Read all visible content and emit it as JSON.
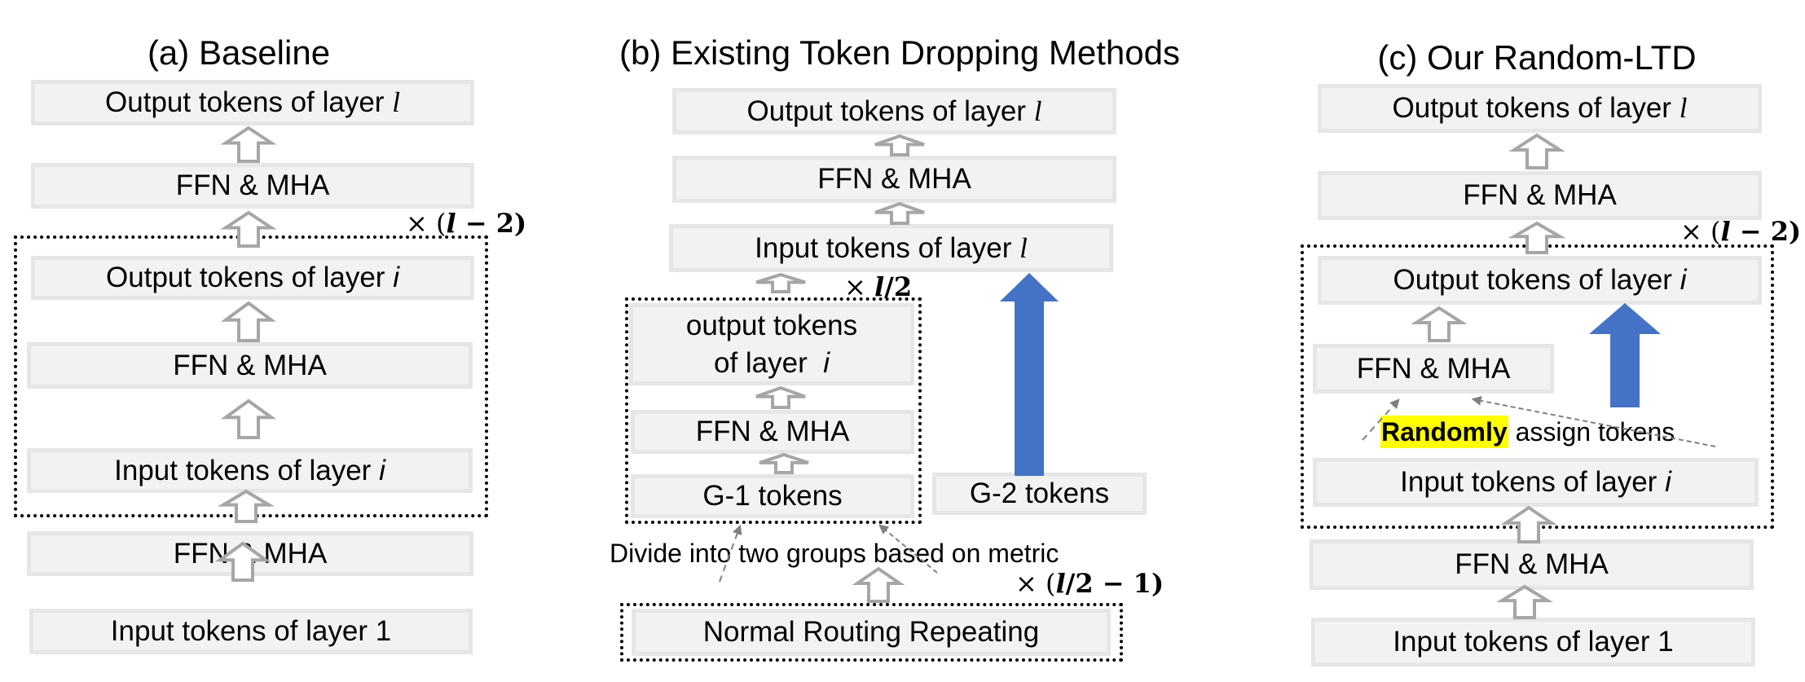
{
  "panels": {
    "a": {
      "title": "(a) Baseline",
      "boxes": {
        "output_l": {
          "text": "Output tokens of layer ",
          "var": "l"
        },
        "ffn_top": {
          "text": "FFN & MHA"
        },
        "output_i": {
          "text": "Output tokens of layer ",
          "var": "i"
        },
        "ffn_mid": {
          "text": "FFN & MHA"
        },
        "input_i": {
          "text": "Input tokens of layer ",
          "var": "i"
        },
        "ffn_bottom": {
          "text": "FFN & MHA"
        },
        "input_1": {
          "text": "Input tokens of layer 1"
        }
      },
      "repeat": {
        "prefix": "× (",
        "var": "l",
        "suffix": " − 2)"
      }
    },
    "b": {
      "title": "(b) Existing Token Dropping Methods",
      "boxes": {
        "output_l": {
          "text": "Output tokens of layer ",
          "var": "l"
        },
        "ffn_top": {
          "text": "FFN & MHA"
        },
        "input_l": {
          "text": "Input tokens of layer ",
          "var": "l"
        },
        "output_i_line1": {
          "text": "output tokens"
        },
        "output_i_line2": {
          "text": "of layer ",
          "var": "i"
        },
        "ffn_mid": {
          "text": "FFN & MHA"
        },
        "g1": {
          "text": "G-1 tokens"
        },
        "g2": {
          "text": "G-2 tokens"
        },
        "normal_routing": {
          "text": "Normal Routing Repeating"
        }
      },
      "repeat_inner": {
        "prefix": "× ",
        "var": "l",
        "suffix": "/2"
      },
      "repeat_outer": {
        "prefix": "× (",
        "var": "l",
        "suffix": "/2 − 1)"
      },
      "divide_note": "Divide into two groups based on metric"
    },
    "c": {
      "title": "(c) Our Random-LTD",
      "boxes": {
        "output_l": {
          "text": "Output tokens of layer ",
          "var": "l"
        },
        "ffn_top": {
          "text": "FFN & MHA"
        },
        "output_i": {
          "text": "Output tokens of layer ",
          "var": "i"
        },
        "ffn_mid": {
          "text": "FFN & MHA"
        },
        "input_i": {
          "text": "Input tokens of layer ",
          "var": "i"
        },
        "ffn_bottom": {
          "text": "FFN & MHA"
        },
        "input_1": {
          "text": "Input tokens of layer 1"
        }
      },
      "repeat": {
        "prefix": "× (",
        "var": "l",
        "suffix": " − 2)"
      },
      "random_note": {
        "highlight": "Randomly",
        "rest": " assign tokens"
      }
    }
  },
  "colors": {
    "box_fill": "#f2f2f2",
    "box_border": "#e6e6e6",
    "arrow_outline": "#a6a6a6",
    "skip_arrow": "#4472c4",
    "dashed_arrow": "#808080",
    "highlight": "#ffff00"
  }
}
